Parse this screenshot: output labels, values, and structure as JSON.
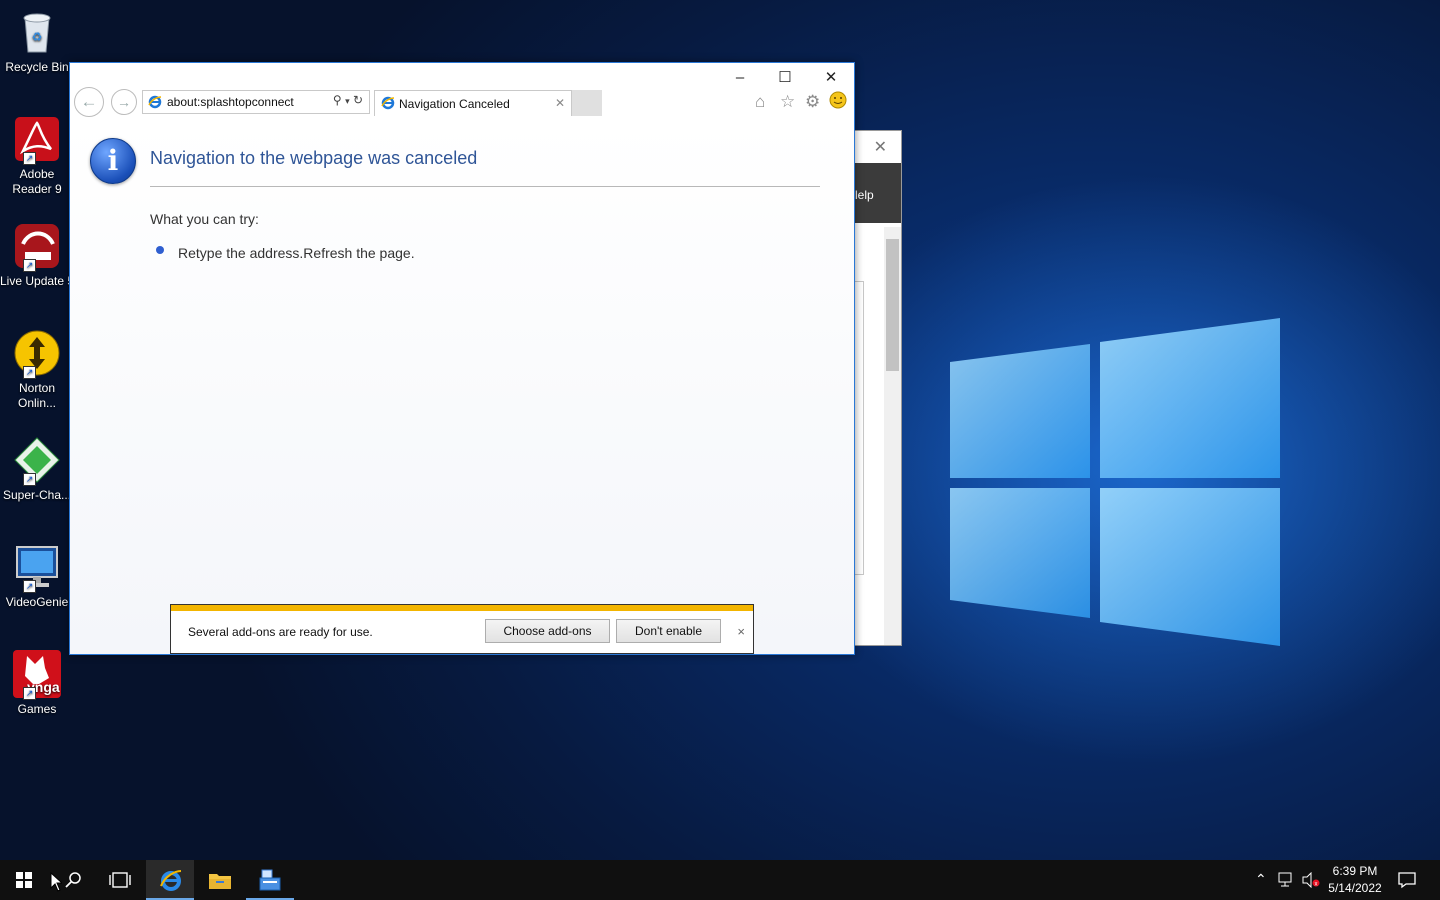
{
  "desktop": {
    "icons": [
      {
        "label": "Recycle Bin",
        "icon": "recycle-bin-icon"
      },
      {
        "label": "Adobe Reader 9",
        "icon": "adobe-reader-icon"
      },
      {
        "label": "Live Update 5",
        "icon": "live-update-icon"
      },
      {
        "label": "Norton Onlin...",
        "icon": "norton-icon"
      },
      {
        "label": "Super-Cha...",
        "icon": "super-charger-icon"
      },
      {
        "label": "VideoGenie",
        "icon": "videogenie-icon"
      },
      {
        "label": "Games",
        "icon": "zynga-games-icon",
        "logo_text": "ynga"
      }
    ]
  },
  "background_window": {
    "menu_text": "lelp"
  },
  "browser": {
    "address": "about:splashtopconnect",
    "tab_title": "Navigation Canceled",
    "heading": "Navigation to the webpage was canceled",
    "try_label": "What you can try:",
    "try_items": [
      "Retype the address.Refresh the page."
    ]
  },
  "notification": {
    "message": "Several add-ons are ready for use.",
    "choose_label": "Choose add-ons",
    "dont_label": "Don't enable",
    "close_label": "×"
  },
  "taskbar": {
    "time": "6:39 PM",
    "date": "5/14/2022"
  },
  "colors": {
    "accent": "#2a78d6",
    "notify_stripe": "#f3b500",
    "heading": "#2f5597"
  }
}
